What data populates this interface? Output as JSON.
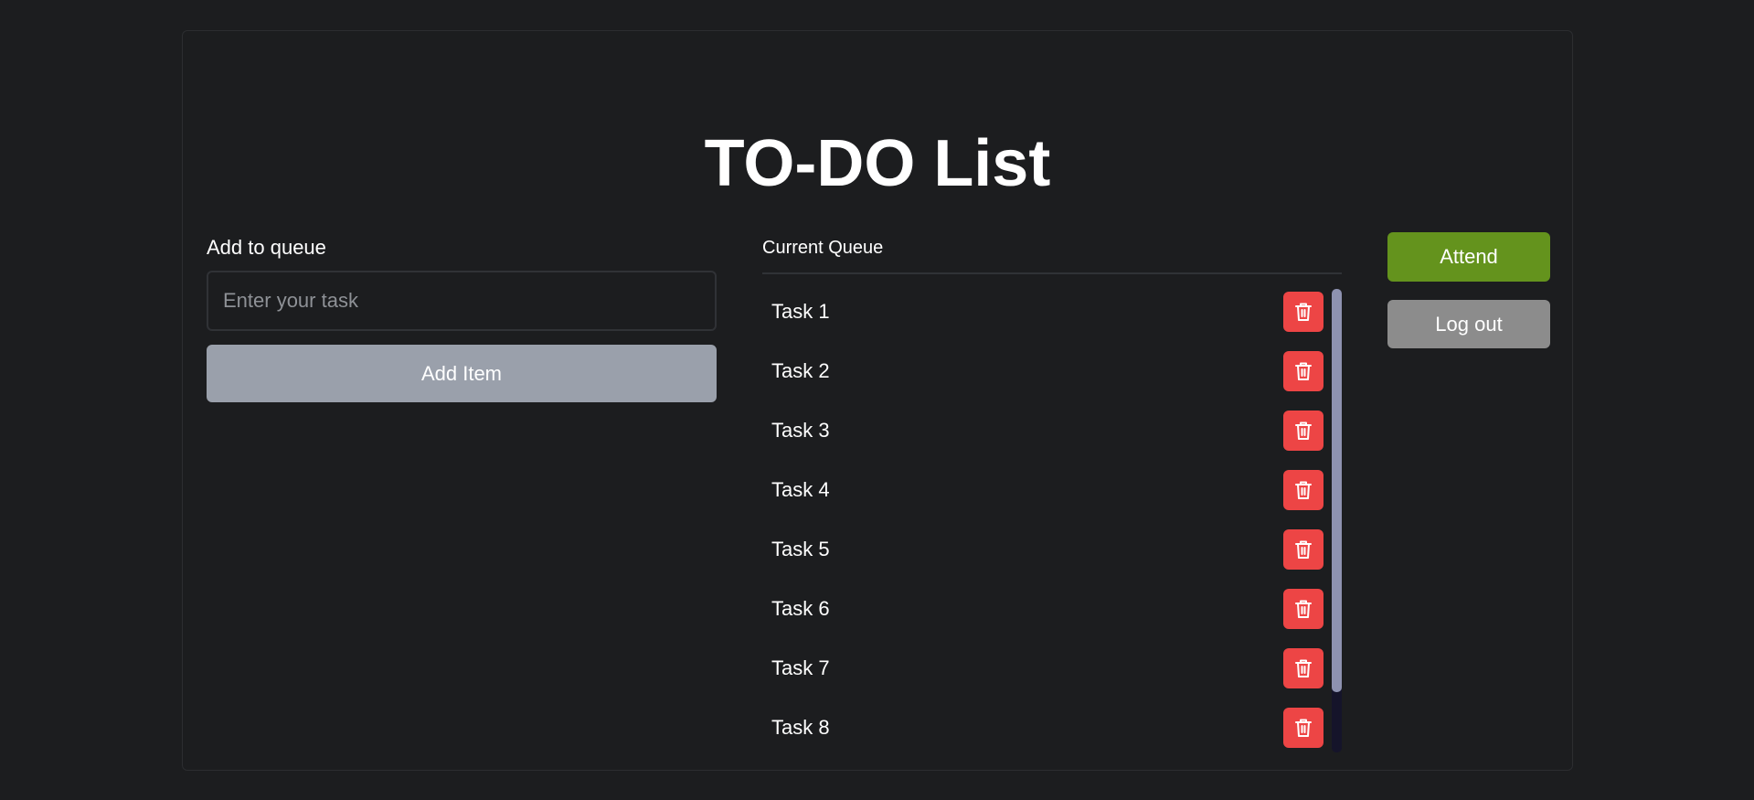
{
  "page": {
    "title": "TO-DO List"
  },
  "add_panel": {
    "label": "Add to queue",
    "input_placeholder": "Enter your task",
    "input_value": "",
    "add_button_label": "Add Item"
  },
  "queue": {
    "header": "Current Queue",
    "items": [
      {
        "label": "Task 1",
        "delete_icon": "trash-icon"
      },
      {
        "label": "Task 2",
        "delete_icon": "trash-icon"
      },
      {
        "label": "Task 3",
        "delete_icon": "trash-icon"
      },
      {
        "label": "Task 4",
        "delete_icon": "trash-icon"
      },
      {
        "label": "Task 5",
        "delete_icon": "trash-icon"
      },
      {
        "label": "Task 6",
        "delete_icon": "trash-icon"
      },
      {
        "label": "Task 7",
        "delete_icon": "trash-icon"
      },
      {
        "label": "Task 8",
        "delete_icon": "trash-icon"
      }
    ]
  },
  "actions": {
    "attend_label": "Attend",
    "logout_label": "Log out"
  },
  "colors": {
    "background": "#1c1d1f",
    "add_button": "#9aa0ab",
    "delete_button": "#ed4545",
    "attend_button": "#64931d",
    "logout_button": "#8c8c8c"
  }
}
